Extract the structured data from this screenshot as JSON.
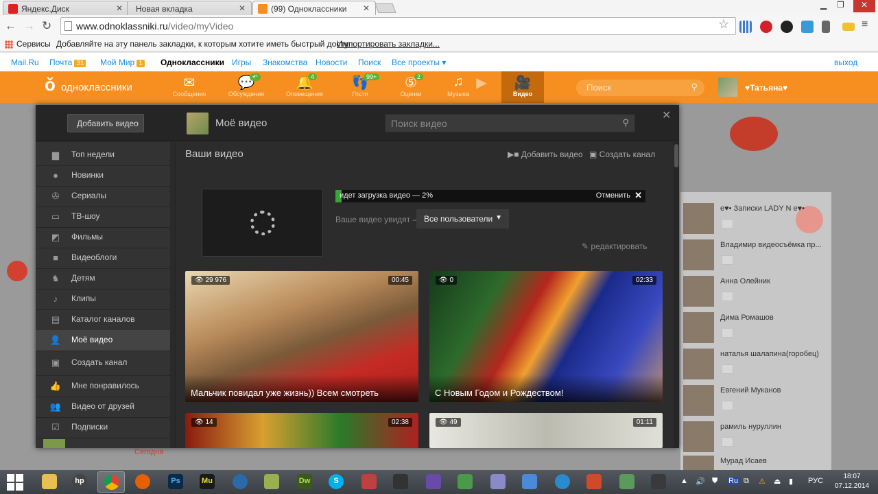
{
  "browser": {
    "tabs": [
      {
        "title": "Яндекс.Диск",
        "active": false
      },
      {
        "title": "Новая вкладка",
        "active": false
      },
      {
        "title": "(99) Одноклассники",
        "active": true
      }
    ],
    "url_host": "www.odnoklassniki.ru",
    "url_path": "/video/myVideo",
    "bookmarks": {
      "apps_label": "Сервисы",
      "hint": "Добавляйте на эту панель закладки, к которым хотите иметь быстрый доступ.",
      "import_link": "Импортировать закладки..."
    }
  },
  "mailbar": {
    "items": [
      {
        "label": "Mail.Ru"
      },
      {
        "label": "Почта",
        "badge": "31"
      },
      {
        "label": "Мой Мир",
        "badge": "1"
      },
      {
        "label": "Одноклассники"
      },
      {
        "label": "Игры"
      },
      {
        "label": "Знакомства"
      },
      {
        "label": "Новости"
      },
      {
        "label": "Поиск"
      },
      {
        "label": "Все проекты ▾"
      }
    ],
    "logout": "выход"
  },
  "ok_header": {
    "logo": "одноклассники",
    "nav": [
      {
        "label": "Сообщения",
        "icon": "envelope-icon",
        "count": ""
      },
      {
        "label": "Обсуждения",
        "icon": "chat-icon",
        "count": "↶"
      },
      {
        "label": "Оповещения",
        "icon": "bell-icon",
        "count": "4"
      },
      {
        "label": "Гости",
        "icon": "footprints-icon",
        "count": "99+"
      },
      {
        "label": "Оценки",
        "icon": "rating-icon",
        "count": "2"
      },
      {
        "label": "Музыка",
        "icon": "music-icon",
        "count": ""
      },
      {
        "label": "Видео",
        "icon": "camera-icon",
        "count": ""
      }
    ],
    "search_placeholder": "Поиск",
    "user_name": "♥Татьяна♥"
  },
  "modal": {
    "add_video_button": "Добавить видео",
    "title": "Моё видео",
    "search_placeholder": "Поиск видео",
    "sidebar": [
      {
        "label": "Топ недели",
        "icon": "bars-icon",
        "active": false
      },
      {
        "label": "Новинки",
        "icon": "circle-icon",
        "active": false
      },
      {
        "label": "Сериалы",
        "icon": "reel-icon",
        "active": false
      },
      {
        "label": "ТВ-шоу",
        "icon": "tv-icon",
        "active": false
      },
      {
        "label": "Фильмы",
        "icon": "clapper-icon",
        "active": false
      },
      {
        "label": "Видеоблоги",
        "icon": "camcorder-icon",
        "active": false
      },
      {
        "label": "Детям",
        "icon": "horse-icon",
        "active": false
      },
      {
        "label": "Клипы",
        "icon": "note-icon",
        "active": false
      },
      {
        "label": "Каталог каналов",
        "icon": "catalog-icon",
        "active": false
      },
      {
        "label": "Моё видео",
        "icon": "user-icon",
        "active": true
      },
      {
        "label": "Создать канал",
        "icon": "channel-icon",
        "active": false
      },
      {
        "label": "Мне понравилось",
        "icon": "like-icon",
        "active": false
      },
      {
        "label": "Видео от друзей",
        "icon": "friends-icon",
        "active": false
      },
      {
        "label": "Подписки",
        "icon": "check-icon",
        "active": false
      }
    ],
    "main": {
      "heading": "Ваши видео",
      "add_video": "Добавить видео",
      "create_channel": "Создать канал",
      "upload_status": "идет загрузка видео — 2%",
      "upload_progress": 0.02,
      "cancel": "Отменить",
      "visibility_label": "Ваше видео увидят —",
      "visibility_value": "Все пользователи",
      "edit": "редактировать"
    },
    "videos": [
      {
        "title": "Мальчик повидал уже жизнь)) Всем смотреть",
        "views": "29 976",
        "duration": "00:45"
      },
      {
        "title": "С Новым Годом и Рождеством!",
        "views": "0",
        "duration": "02:33"
      },
      {
        "title": "",
        "views": "14",
        "duration": "02:38"
      },
      {
        "title": "",
        "views": "49",
        "duration": "01:11"
      }
    ]
  },
  "friends": [
    {
      "name": "e♥• Записки LADY N e♥•"
    },
    {
      "name": "Владимир видеосъёмка пр..."
    },
    {
      "name": "Анна Олейник"
    },
    {
      "name": "Дима Ромашов"
    },
    {
      "name": "наталья шалапина(горобец)"
    },
    {
      "name": "Евгений Муканов"
    },
    {
      "name": "рамиль нуруллин"
    },
    {
      "name": "Мурад Исаев"
    }
  ],
  "background_text": "Сегодня",
  "taskbar": {
    "lang": "РУС",
    "time": "18:07",
    "date": "07.12.2014"
  }
}
